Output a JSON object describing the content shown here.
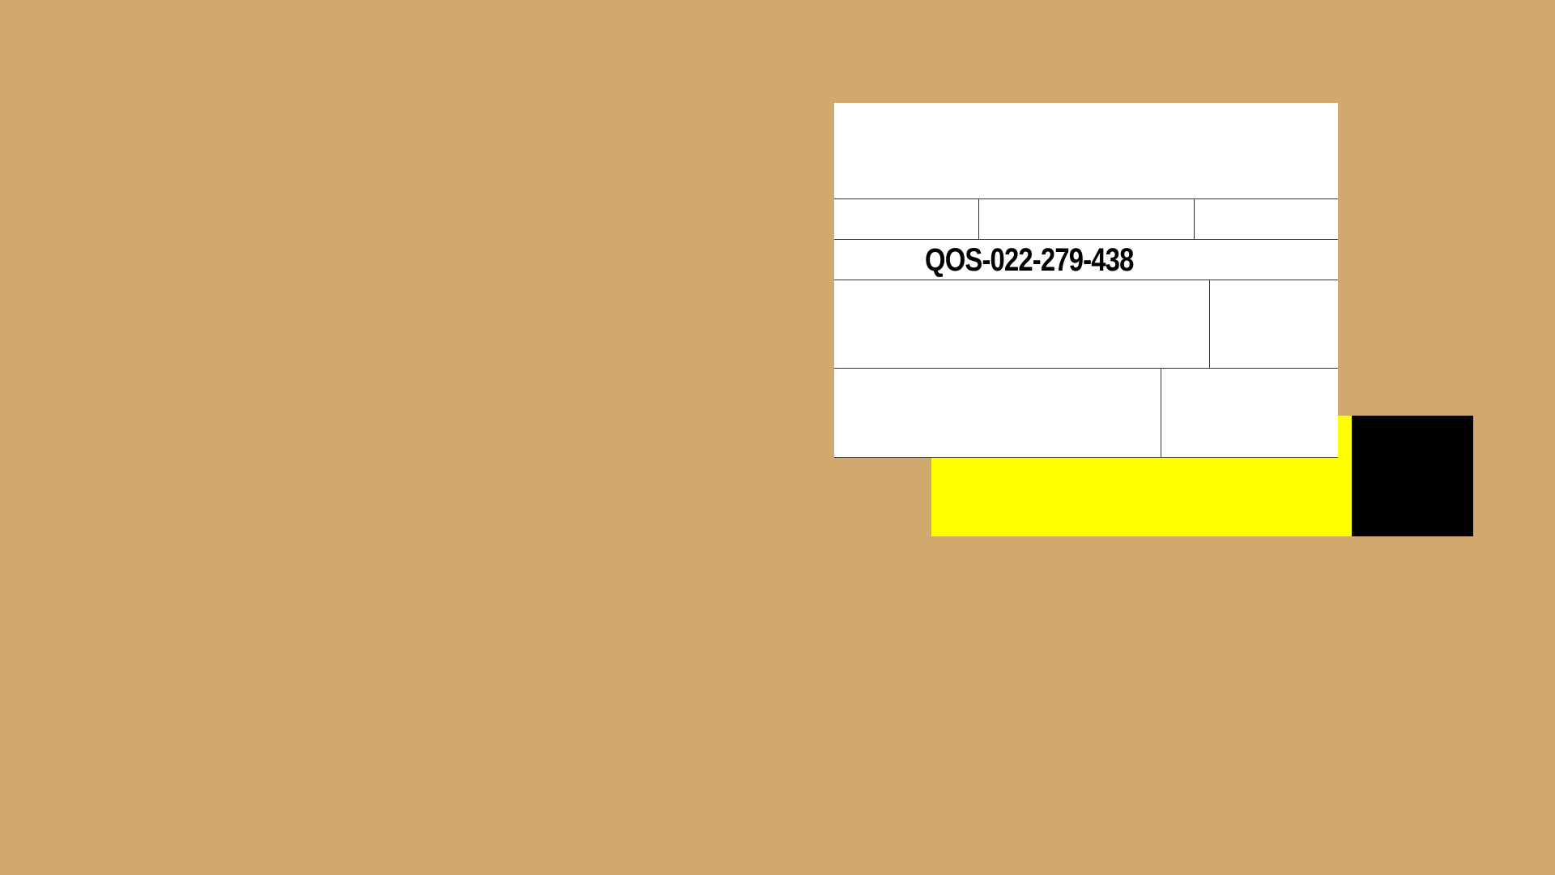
{
  "label": {
    "tracking_number": "QOS-022-279-438"
  },
  "colors": {
    "background": "#d1a86e",
    "yellow_block": "#ffff00",
    "black_block": "#000000",
    "card": "#ffffff"
  }
}
